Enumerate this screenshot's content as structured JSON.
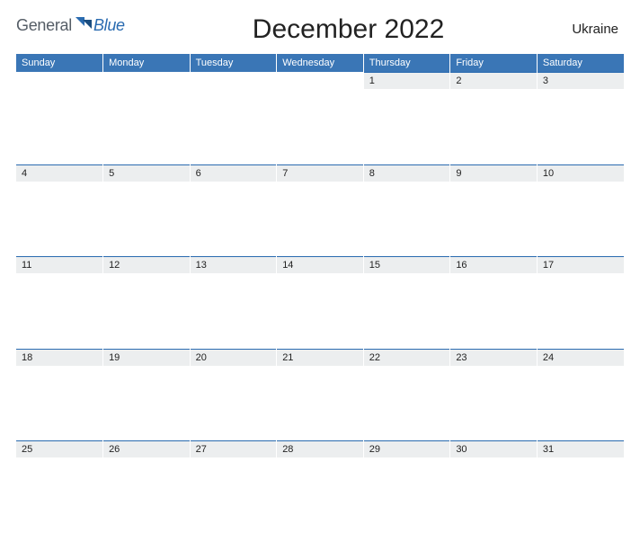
{
  "header": {
    "logo_general": "General",
    "logo_blue": "Blue",
    "title": "December 2022",
    "region": "Ukraine"
  },
  "days": [
    "Sunday",
    "Monday",
    "Tuesday",
    "Wednesday",
    "Thursday",
    "Friday",
    "Saturday"
  ],
  "weeks": [
    [
      "",
      "",
      "",
      "",
      "1",
      "2",
      "3"
    ],
    [
      "4",
      "5",
      "6",
      "7",
      "8",
      "9",
      "10"
    ],
    [
      "11",
      "12",
      "13",
      "14",
      "15",
      "16",
      "17"
    ],
    [
      "18",
      "19",
      "20",
      "21",
      "22",
      "23",
      "24"
    ],
    [
      "25",
      "26",
      "27",
      "28",
      "29",
      "30",
      "31"
    ]
  ],
  "colors": {
    "accent": "#3a76b6",
    "rule": "#2a6bb0",
    "daystrip": "#eceeef"
  }
}
